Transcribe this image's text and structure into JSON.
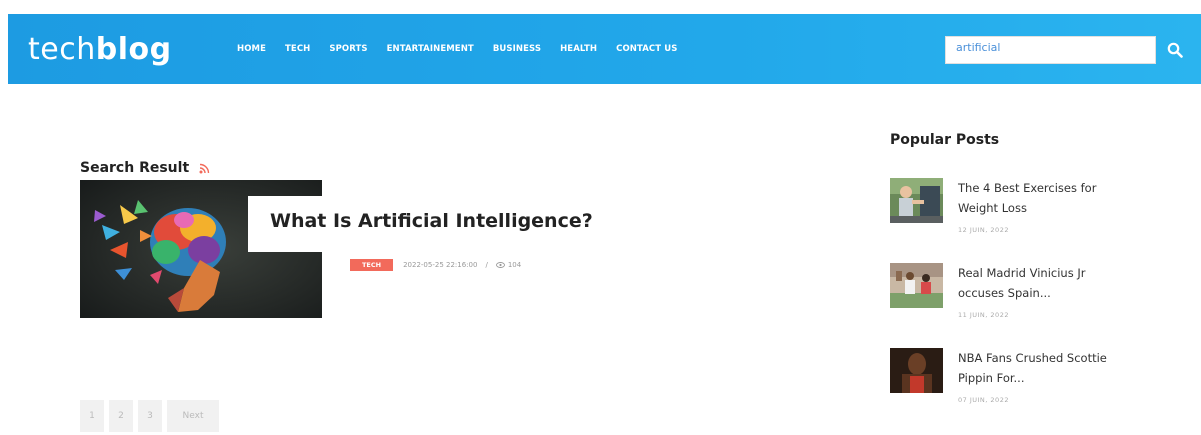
{
  "header": {
    "logo_light": "tech",
    "logo_bold": "blog",
    "nav": [
      "HOME",
      "TECH",
      "SPORTS",
      "ENTARTAINEMENT",
      "BUSINESS",
      "HEALTH",
      "CONTACT US"
    ],
    "search_value": "artificial",
    "colors": {
      "bar": "#1d9be2"
    }
  },
  "main": {
    "section_title": "Search Result",
    "post": {
      "title": "What Is Artificial Intelligence?",
      "tag": "TECH",
      "date": "2022-05-25 22:16:00",
      "separator": "/",
      "views": "104"
    },
    "pagination": [
      "1",
      "2",
      "3",
      "Next"
    ]
  },
  "sidebar": {
    "title": "Popular Posts",
    "posts": [
      {
        "title": "The 4 Best Exercises for Weight Loss",
        "date": "12 JUIN, 2022"
      },
      {
        "title": "Real Madrid Vinicius Jr occuses Spain...",
        "date": "11 JUIN, 2022"
      },
      {
        "title": "NBA Fans Crushed Scottie Pippin For...",
        "date": "07 JUIN, 2022"
      }
    ]
  }
}
